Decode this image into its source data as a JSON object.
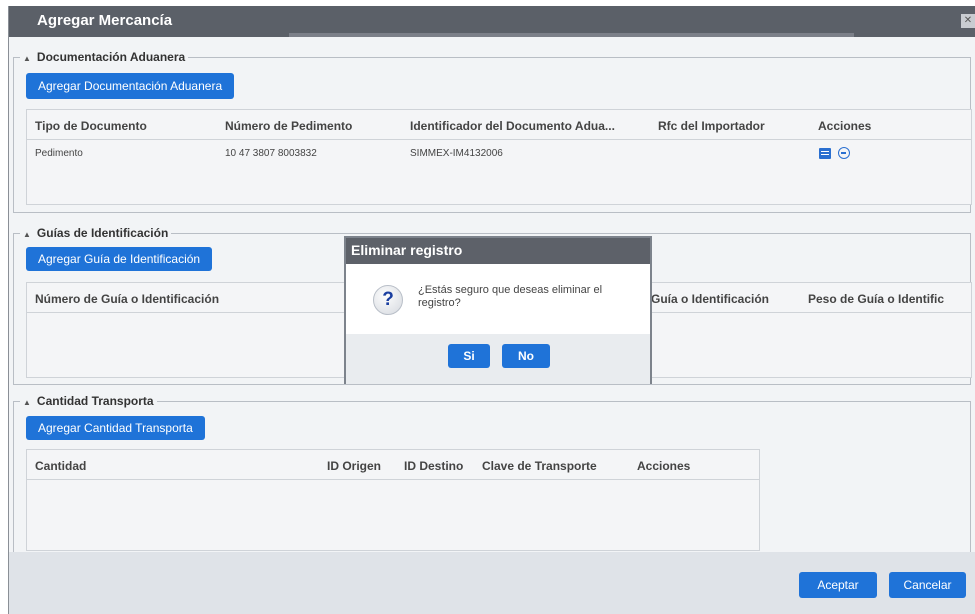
{
  "window": {
    "title": "Agregar Mercancía",
    "close_glyph": "✕"
  },
  "doc_section": {
    "legend": "Documentación Aduanera",
    "add_button": "Agregar Documentación Aduanera",
    "columns": [
      "Tipo de Documento",
      "Número de Pedimento",
      "Identificador del Documento Adua...",
      "Rfc del Importador",
      "Acciones"
    ],
    "rows": [
      {
        "tipo": "Pedimento",
        "numero": "10 47 3807 8003832",
        "identificador": "SIMMEX-IM4132006",
        "rfc": "",
        "actions": [
          "edit-icon",
          "remove-icon"
        ]
      }
    ]
  },
  "guias_section": {
    "legend": "Guías de Identificación",
    "add_button": "Agregar Guía de Identificación",
    "columns": [
      "Número de Guía o Identificación",
      "Guía o Identificación",
      "Peso de Guía o Identific"
    ]
  },
  "cantidad_section": {
    "legend": "Cantidad Transporta",
    "add_button": "Agregar Cantidad Transporta",
    "columns": [
      "Cantidad",
      "ID Origen",
      "ID Destino",
      "Clave de Transporte",
      "Acciones"
    ]
  },
  "footer": {
    "accept": "Aceptar",
    "cancel": "Cancelar"
  },
  "modal": {
    "title": "Eliminar registro",
    "message": "¿Estás seguro que deseas eliminar el registro?",
    "icon": "question-icon",
    "yes": "Si",
    "no": "No"
  },
  "colors": {
    "accent": "#1f73d8",
    "titlebar": "#5b6068"
  }
}
